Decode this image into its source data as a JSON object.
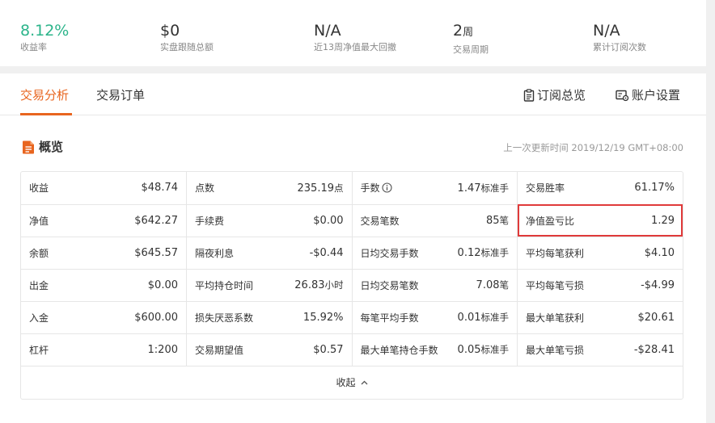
{
  "stats": [
    {
      "value": "8.12%",
      "unit": "",
      "label": "收益率"
    },
    {
      "value": "$0",
      "unit": "",
      "label": "实盘跟随总额"
    },
    {
      "value": "N/A",
      "unit": "",
      "label": "近13周净值最大回撤"
    },
    {
      "value": "2",
      "unit": "周",
      "label": "交易周期"
    },
    {
      "value": "N/A",
      "unit": "",
      "label": "累计订阅次数"
    }
  ],
  "tabs": {
    "analysis": "交易分析",
    "orders": "交易订单",
    "subscription": "订阅总览",
    "account_settings": "账户设置"
  },
  "overview": {
    "title": "概览",
    "updated": "上一次更新时间 2019/12/19 GMT+08:00",
    "collapse_label": "收起"
  },
  "grid": [
    [
      {
        "label": "收益",
        "value": "$48.74",
        "unit": ""
      },
      {
        "label": "点数",
        "value": "235.19",
        "unit": "点"
      },
      {
        "label": "手数",
        "value": "1.47",
        "unit": "标准手",
        "info": true
      },
      {
        "label": "交易胜率",
        "value": "61.17%",
        "unit": ""
      }
    ],
    [
      {
        "label": "净值",
        "value": "$642.27",
        "unit": ""
      },
      {
        "label": "手续费",
        "value": "$0.00",
        "unit": ""
      },
      {
        "label": "交易笔数",
        "value": "85",
        "unit": "笔"
      },
      {
        "label": "净值盈亏比",
        "value": "1.29",
        "unit": "",
        "highlight": true
      }
    ],
    [
      {
        "label": "余额",
        "value": "$645.57",
        "unit": ""
      },
      {
        "label": "隔夜利息",
        "value": "-$0.44",
        "unit": ""
      },
      {
        "label": "日均交易手数",
        "value": "0.12",
        "unit": "标准手"
      },
      {
        "label": "平均每笔获利",
        "value": "$4.10",
        "unit": ""
      }
    ],
    [
      {
        "label": "出金",
        "value": "$0.00",
        "unit": ""
      },
      {
        "label": "平均持仓时间",
        "value": "26.83",
        "unit": "小时"
      },
      {
        "label": "日均交易笔数",
        "value": "7.08",
        "unit": "笔"
      },
      {
        "label": "平均每笔亏损",
        "value": "-$4.99",
        "unit": ""
      }
    ],
    [
      {
        "label": "入金",
        "value": "$600.00",
        "unit": ""
      },
      {
        "label": "损失厌恶系数",
        "value": "15.92%",
        "unit": ""
      },
      {
        "label": "每笔平均手数",
        "value": "0.01",
        "unit": "标准手"
      },
      {
        "label": "最大单笔获利",
        "value": "$20.61",
        "unit": ""
      }
    ],
    [
      {
        "label": "杠杆",
        "value": "1:200",
        "unit": ""
      },
      {
        "label": "交易期望值",
        "value": "$0.57",
        "unit": ""
      },
      {
        "label": "最大单笔持仓手数",
        "value": "0.05",
        "unit": "标准手"
      },
      {
        "label": "最大单笔亏损",
        "value": "-$28.41",
        "unit": ""
      }
    ]
  ],
  "colors": {
    "accent": "#e8651f",
    "positive": "#2bb48a",
    "highlight": "#e03a3a"
  },
  "icons": {
    "overview": "document-icon",
    "subscription": "clipboard-icon",
    "account_settings": "settings-icon",
    "info": "info-icon",
    "collapse": "chevron-up-icon"
  }
}
